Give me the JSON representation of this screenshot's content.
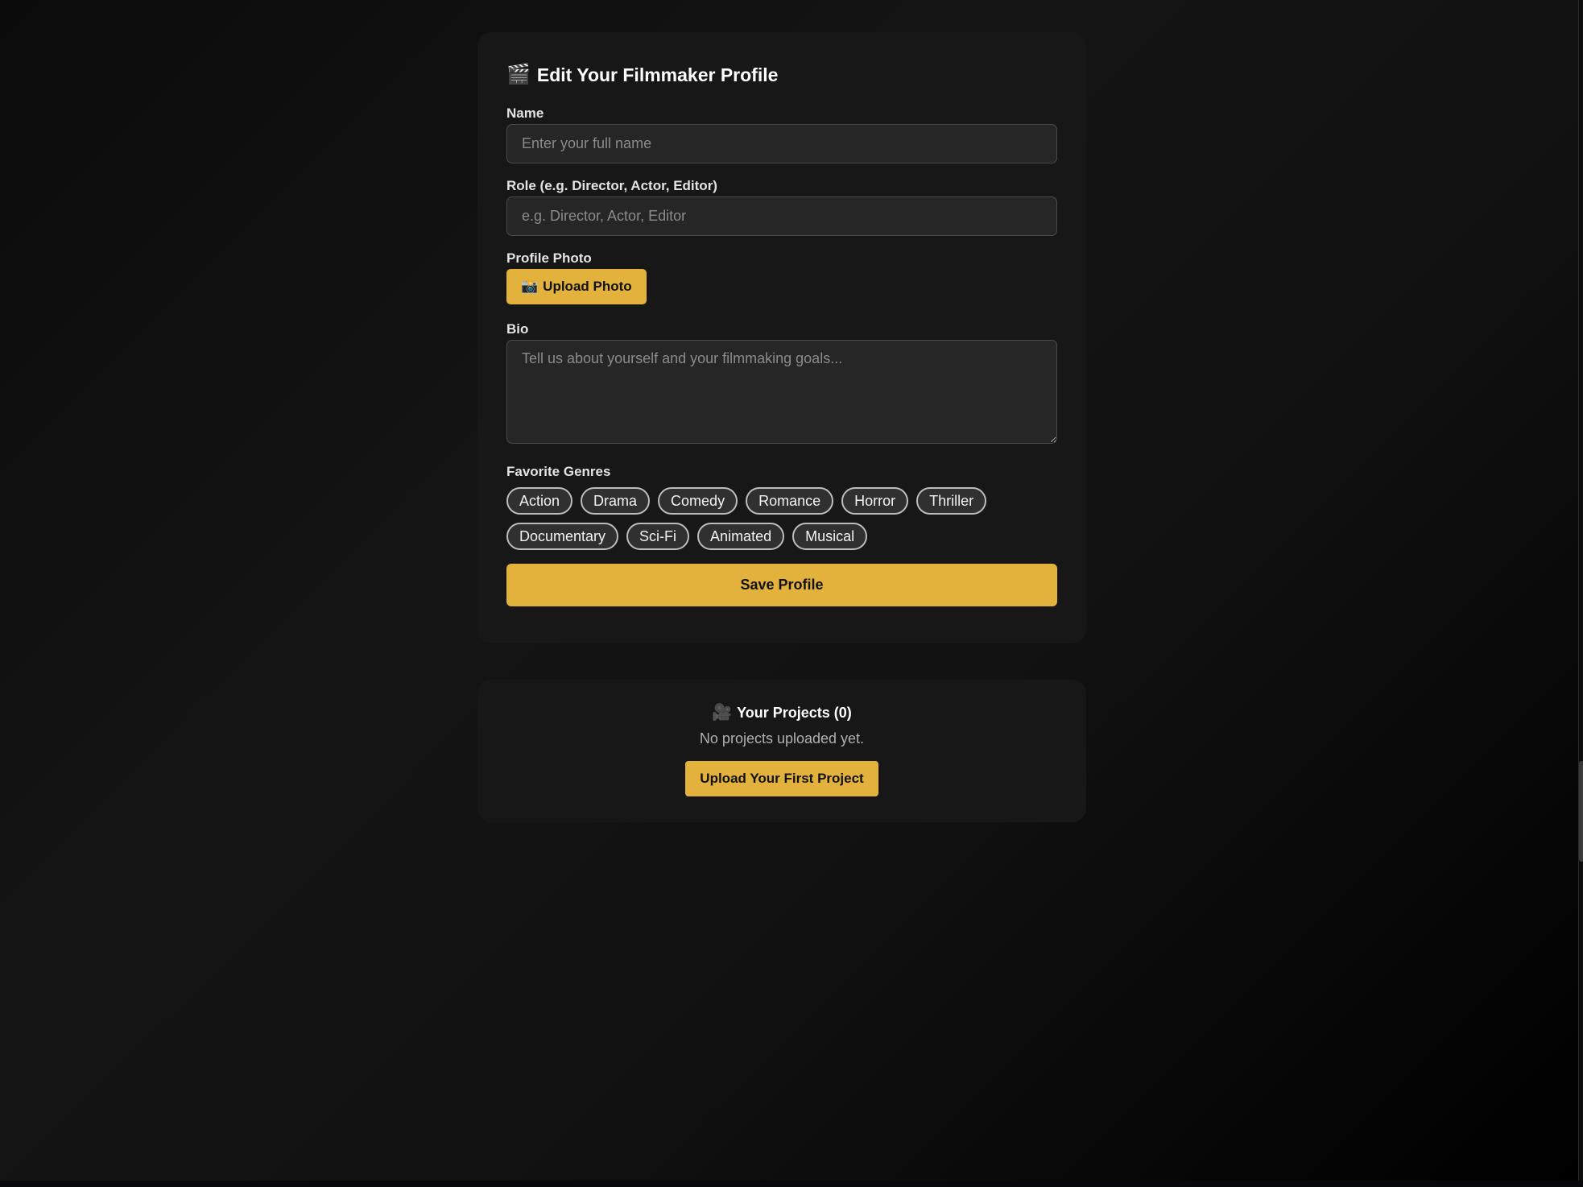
{
  "profile": {
    "title_icon": "🎬",
    "title": "Edit Your Filmmaker Profile",
    "name_label": "Name",
    "name_placeholder": "Enter your full name",
    "role_label": "Role (e.g. Director, Actor, Editor)",
    "role_placeholder": "e.g. Director, Actor, Editor",
    "photo_label": "Profile Photo",
    "upload_icon": "📸",
    "upload_label": "Upload Photo",
    "bio_label": "Bio",
    "bio_placeholder": "Tell us about yourself and your filmmaking goals...",
    "genres_label": "Favorite Genres",
    "genres": [
      "Action",
      "Drama",
      "Comedy",
      "Romance",
      "Horror",
      "Thriller",
      "Documentary",
      "Sci-Fi",
      "Animated",
      "Musical"
    ],
    "save_label": "Save Profile"
  },
  "projects": {
    "title_icon": "🎥",
    "title": "Your Projects (0)",
    "empty_text": "No projects uploaded yet.",
    "upload_label": "Upload Your First Project"
  },
  "colors": {
    "accent": "#e3b23c",
    "card": "#171717",
    "background": "#0b0b0b"
  }
}
